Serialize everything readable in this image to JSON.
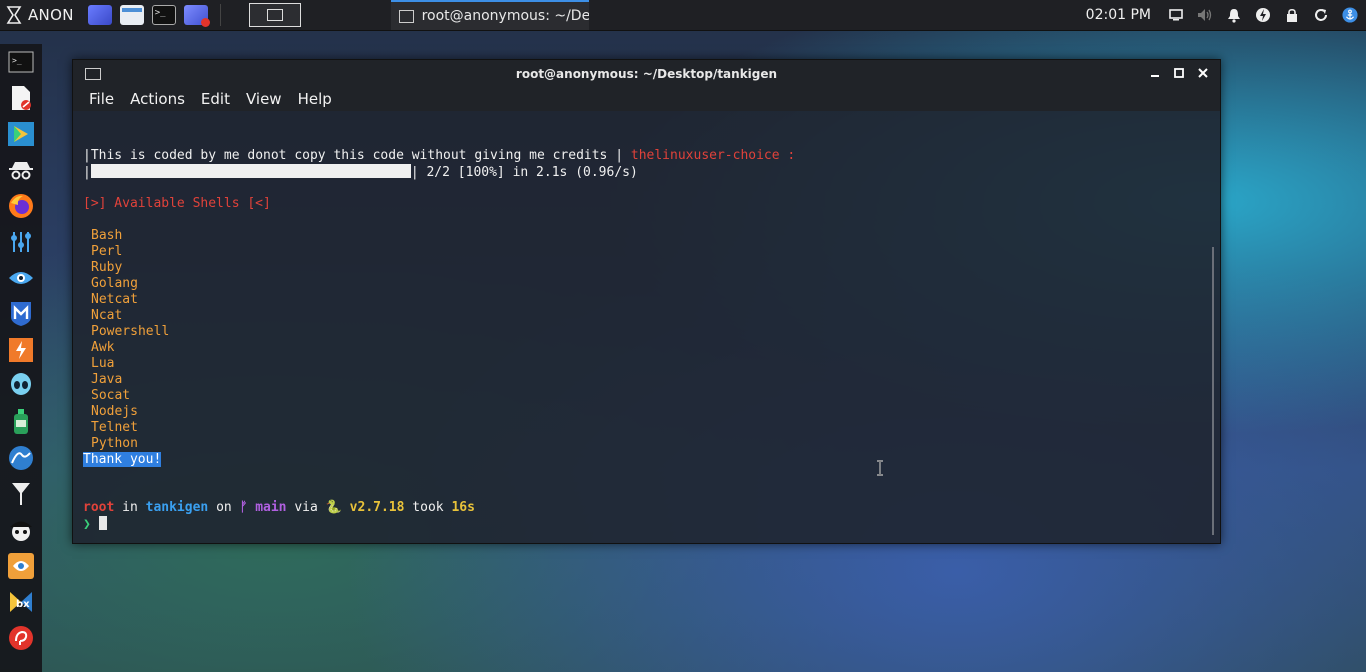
{
  "top_panel": {
    "brand_label": "ANON",
    "task_label": "root@anonymous: ~/De...",
    "clock": "02:01 PM"
  },
  "window": {
    "title": "root@anonymous: ~/Desktop/tankigen",
    "menu": [
      "File",
      "Actions",
      "Edit",
      "View",
      "Help"
    ]
  },
  "terminal": {
    "banner_text": "This is coded by me donot copy this code without giving me credits",
    "banner_sep": "|",
    "banner_author": "thelinuxuser-choice :",
    "progress_stats": "2/2 [100%] in 2.1s (0.96/s)",
    "progress_fraction": 1.0,
    "shells_header": "[>] Available Shells [<]",
    "shells": [
      "Bash",
      "Perl",
      "Ruby",
      "Golang",
      "Netcat",
      "Ncat",
      "Powershell",
      "Awk",
      "Lua",
      "Java",
      "Socat",
      "Nodejs",
      "Telnet",
      "Python"
    ],
    "thanks": "Thank you!",
    "prompt": {
      "user": "root",
      "in": "in",
      "dir": "tankigen",
      "on": "on",
      "branch_icon": "git-branch-icon",
      "branch": "main",
      "via": "via",
      "lang_icon": "python-icon",
      "version": "v2.7.18",
      "took": "took",
      "duration": "16s",
      "symbol": "❯"
    }
  },
  "colors": {
    "prompt_user": "#e0423a",
    "prompt_dir": "#3aa0f0",
    "prompt_branch": "#b060e0",
    "prompt_version": "#e8c23a",
    "shell_list": "#f0a03a",
    "header": "#e0423a",
    "selection": "#2f7fe0",
    "active_task": "#3d8fe6"
  }
}
